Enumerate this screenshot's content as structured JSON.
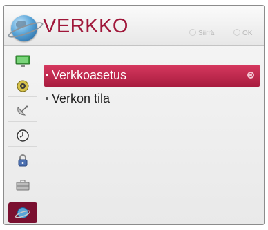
{
  "header": {
    "title": "VERKKO",
    "hint_move": "Siirrä",
    "hint_ok": "OK",
    "icon": "network-globe-icon"
  },
  "sidebar": {
    "items": [
      {
        "icon": "picture-monitor-icon"
      },
      {
        "icon": "audio-speaker-icon"
      },
      {
        "icon": "satellite-dish-icon"
      },
      {
        "icon": "clock-icon"
      },
      {
        "icon": "lock-icon"
      },
      {
        "icon": "options-briefcase-icon"
      },
      {
        "icon": "network-globe-icon",
        "active": true
      }
    ]
  },
  "menu": {
    "items": [
      {
        "label": "Verkkoasetus",
        "selected": true
      },
      {
        "label": "Verkon tila",
        "selected": false
      }
    ]
  },
  "colors": {
    "title": "#a0173a",
    "selection": "#c42a50",
    "active_sidebar": "#7a1030"
  }
}
